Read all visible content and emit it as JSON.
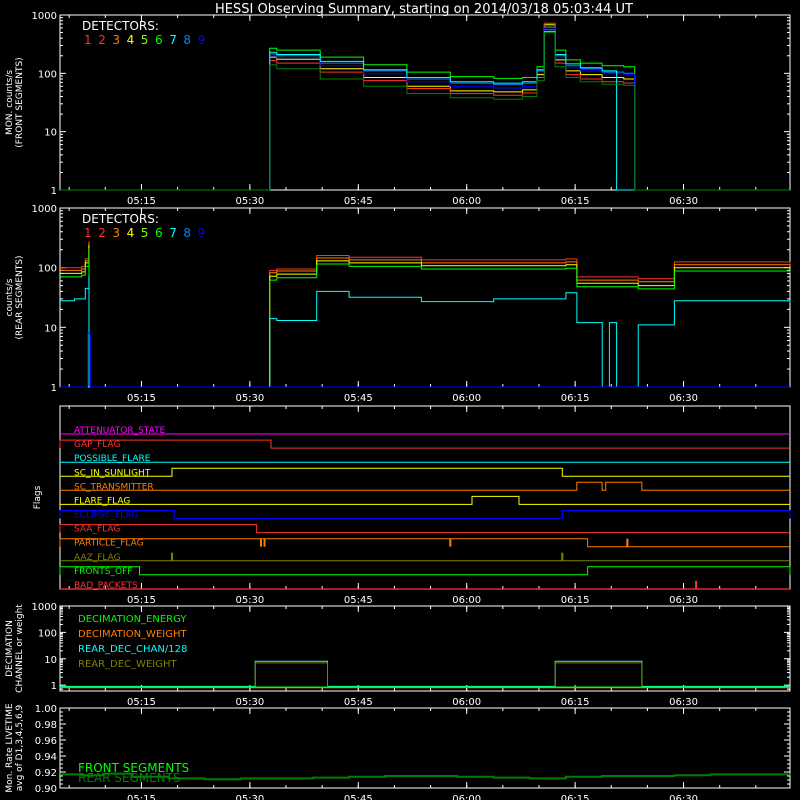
{
  "chart_data": {
    "title": "HESSI Observing Summary, starting on 2014/03/18 05:03:44 UT",
    "time_ticks": [
      "05:15",
      "05:30",
      "05:45",
      "06:00",
      "06:15",
      "06:30"
    ],
    "time_tick_minutes": [
      11.27,
      26.27,
      41.27,
      56.27,
      71.27,
      86.27
    ],
    "time_range_minutes": [
      0,
      101
    ],
    "detector_colors": [
      "#ff3030",
      "#ff3030",
      "#ff7f00",
      "#ffff00",
      "#7fff00",
      "#00ff00",
      "#00ffff",
      "#0080ff",
      "#0000ff"
    ],
    "detector_numbers": [
      "1",
      "2",
      "3",
      "4",
      "5",
      "6",
      "7",
      "8",
      "9"
    ],
    "panels": [
      {
        "id": "front",
        "type": "line",
        "ylabel_line1": "MON. counts/s",
        "ylabel_line2": "(FRONT SEGMENTS)",
        "legend_label": "DETECTORS:",
        "yscale": "log",
        "ylim": [
          1,
          1000
        ],
        "yticks": [
          "1",
          "10",
          "100",
          "1000"
        ],
        "series": [
          {
            "color": "#00ff00",
            "x": [
              0,
              29.0,
              29.01,
              30,
              36,
              42,
              48,
              54,
              60,
              64,
              66,
              67,
              68.5,
              70,
              72,
              75,
              78,
              79.5,
              79.51,
              101
            ],
            "y": [
              1,
              1,
              270,
              250,
              190,
              140,
              105,
              88,
              82,
              85,
              130,
              620,
              250,
              170,
              150,
              135,
              130,
              130,
              1,
              1
            ]
          },
          {
            "color": "#ffff00",
            "x": [
              0,
              29.0,
              29.01,
              30,
              36,
              42,
              48,
              54,
              60,
              64,
              66,
              67,
              68.5,
              70,
              72,
              75,
              78,
              79.5,
              79.51,
              101
            ],
            "y": [
              1,
              1,
              190,
              175,
              120,
              85,
              60,
              50,
              48,
              52,
              95,
              680,
              170,
              110,
              95,
              85,
              80,
              80,
              1,
              1
            ]
          },
          {
            "color": "#ff3030",
            "x": [
              0,
              29.0,
              29.01,
              30,
              36,
              42,
              48,
              54,
              60,
              64,
              66,
              67,
              68.5,
              70,
              72,
              75,
              78,
              79.5,
              79.51,
              101
            ],
            "y": [
              1,
              1,
              165,
              150,
              105,
              75,
              55,
              45,
              42,
              46,
              85,
              720,
              150,
              95,
              80,
              72,
              68,
              68,
              1,
              1
            ]
          },
          {
            "color": "#0080ff",
            "x": [
              0,
              29.0,
              29.01,
              30,
              36,
              42,
              48,
              54,
              60,
              64,
              66,
              67,
              68.5,
              70,
              72,
              75,
              78,
              79.5,
              79.51,
              101
            ],
            "y": [
              1,
              1,
              215,
              200,
              150,
              110,
              80,
              68,
              64,
              68,
              110,
              560,
              200,
              135,
              120,
              105,
              100,
              100,
              1,
              1
            ]
          },
          {
            "color": "#0000ff",
            "x": [
              0,
              29.0,
              29.01,
              30,
              36,
              42,
              48,
              54,
              60,
              64,
              66,
              67,
              68.5,
              70,
              72,
              75,
              78,
              79.5,
              79.51,
              101
            ],
            "y": [
              1,
              1,
              200,
              185,
              135,
              98,
              72,
              60,
              56,
              60,
              100,
              600,
              185,
              125,
              110,
              98,
              95,
              95,
              1,
              1
            ]
          },
          {
            "color": "#00ffff",
            "x": [
              0,
              29.0,
              29.01,
              30,
              36,
              42,
              48,
              54,
              60,
              64,
              66,
              67,
              68.5,
              70,
              72,
              75,
              77.0,
              77.01,
              101
            ],
            "y": [
              1,
              1,
              230,
              210,
              160,
              115,
              85,
              72,
              68,
              72,
              115,
              520,
              210,
              145,
              125,
              110,
              105,
              1,
              1
            ]
          },
          {
            "color": "#008000",
            "x": [
              0,
              29.0,
              29.01,
              30,
              36,
              42,
              48,
              54,
              60,
              64,
              66,
              67,
              68.5,
              70,
              72,
              75,
              78,
              79.5,
              79.51,
              101
            ],
            "y": [
              1,
              1,
              140,
              120,
              80,
              60,
              45,
              38,
              36,
              40,
              75,
              500,
              130,
              85,
              72,
              65,
              62,
              62,
              1,
              1
            ]
          }
        ]
      },
      {
        "id": "rear",
        "type": "line",
        "ylabel_line1": "counts/s",
        "ylabel_line2": "(REAR SEGMENTS)",
        "legend_label": "DETECTORS:",
        "yscale": "log",
        "ylim": [
          1,
          1000
        ],
        "yticks": [
          "1",
          "10",
          "100",
          "1000"
        ],
        "series": [
          {
            "color": "#ff3030",
            "x": [
              0,
              3,
              3.5,
              4.0,
              4.01,
              29.0,
              29.01,
              30,
              35.5,
              35.51,
              40,
              50,
              60,
              70,
              71.5,
              71.51,
              80,
              85,
              85.01,
              101
            ],
            "y": [
              100,
              105,
              140,
              270,
              1,
              1,
              90,
              95,
              95,
              160,
              150,
              135,
              135,
              140,
              140,
              70,
              65,
              65,
              125,
              115
            ]
          },
          {
            "color": "#ff7f00",
            "x": [
              0,
              3,
              3.5,
              4.0,
              4.01,
              29.0,
              29.01,
              30,
              35.5,
              35.51,
              40,
              50,
              60,
              70,
              71.5,
              71.51,
              80,
              85,
              85.01,
              101
            ],
            "y": [
              90,
              95,
              130,
              250,
              1,
              1,
              82,
              88,
              88,
              145,
              135,
              120,
              120,
              125,
              125,
              62,
              58,
              58,
              112,
              105
            ]
          },
          {
            "color": "#ffff00",
            "x": [
              0,
              3,
              3.5,
              4.0,
              4.01,
              29.0,
              29.01,
              30,
              35.5,
              35.51,
              40,
              50,
              60,
              70,
              71.5,
              71.51,
              80,
              85,
              85.01,
              101
            ],
            "y": [
              80,
              85,
              120,
              230,
              1,
              1,
              72,
              78,
              78,
              130,
              120,
              108,
              108,
              112,
              112,
              55,
              50,
              50,
              100,
              95
            ]
          },
          {
            "color": "#00ff00",
            "x": [
              0,
              3,
              3.5,
              4.0,
              4.01,
              29.0,
              29.01,
              30,
              35.5,
              35.51,
              40,
              50,
              60,
              70,
              71.5,
              71.51,
              80,
              85,
              85.01,
              101
            ],
            "y": [
              70,
              75,
              105,
              210,
              1,
              1,
              62,
              68,
              68,
              115,
              105,
              95,
              95,
              98,
              98,
              48,
              44,
              44,
              88,
              82
            ]
          },
          {
            "color": "#00ffff",
            "x": [
              0,
              2,
              3.5,
              4.0,
              4.01,
              29.0,
              29.01,
              30,
              35.5,
              35.51,
              40,
              50,
              60,
              70,
              71.5,
              71.51,
              75,
              75.01,
              76,
              76.01,
              77,
              77.01,
              80,
              85,
              85.01,
              101
            ],
            "y": [
              28,
              30,
              45,
              70,
              1,
              1,
              14,
              13,
              13,
              40,
              32,
              27,
              30,
              38,
              38,
              12,
              12,
              1,
              1,
              12,
              12,
              1,
              11,
              11,
              28,
              26
            ]
          },
          {
            "color": "#0000ff",
            "x": [
              0,
              3.8,
              3.81,
              4.2,
              4.21,
              101
            ],
            "y": [
              1,
              1,
              8,
              8,
              1,
              1
            ]
          }
        ]
      },
      {
        "id": "flags",
        "type": "flags",
        "ylabel": "Flags",
        "rows": [
          {
            "label": "ATTENUATOR_STATE",
            "color": "#ff00ff",
            "segments": []
          },
          {
            "label": "GAP_FLAG",
            "color": "#ff3030",
            "segments": [
              [
                0,
                29.2
              ]
            ]
          },
          {
            "label": "POSSIBLE_FLARE",
            "color": "#00ffff",
            "segments": []
          },
          {
            "label": "SC_IN_SUNLIGHT",
            "color": "#ffff00",
            "segments": [
              [
                15.5,
                69.5
              ]
            ]
          },
          {
            "label": "SC_TRANSMITTER",
            "color": "#ff7f00",
            "segments": [
              [
                71.5,
                75.0
              ],
              [
                75.5,
                80.5
              ]
            ]
          },
          {
            "label": "FLARE_FLAG",
            "color": "#ffff00",
            "segments": [
              [
                57.0,
                63.5
              ]
            ]
          },
          {
            "label": "ECLIPSE_FLAG",
            "color": "#0000ff",
            "segments": [
              [
                0,
                15.8
              ],
              [
                69.5,
                101
              ]
            ]
          },
          {
            "label": "SAA_FLAG",
            "color": "#ff3030",
            "segments": [
              [
                0,
                27.2
              ]
            ]
          },
          {
            "label": "PARTICLE_FLAG",
            "color": "#ff7f00",
            "segments": [
              [
                0,
                73.0
              ]
            ],
            "spikes": [
              27.8,
              28.3,
              54.0,
              78.5
            ]
          },
          {
            "label": "AAZ_FLAG",
            "color": "#808000",
            "segments": [],
            "spikes": [
              15.5,
              69.5
            ]
          },
          {
            "label": "FRONTS_OFF",
            "color": "#00ff00",
            "segments": [
              [
                0,
                11.0
              ],
              [
                73.0,
                101
              ]
            ]
          },
          {
            "label": "BAD_PACKETS",
            "color": "#ff3030",
            "segments": [],
            "spikes": [
              88.0
            ]
          }
        ]
      },
      {
        "id": "decimation",
        "type": "line",
        "ylabel_line1": "DECIMATION",
        "ylabel_line2": "CHANNEL or weight",
        "yscale": "log",
        "ylim": [
          0.6,
          1000
        ],
        "yticks": [
          "1",
          "10",
          "100",
          "1000"
        ],
        "legend": [
          {
            "label": "DECIMATION_ENERGY",
            "color": "#00ff00"
          },
          {
            "label": "DECIMATION_WEIGHT",
            "color": "#ff7f00"
          },
          {
            "label": "REAR_DEC_CHAN/128",
            "color": "#00ffff"
          },
          {
            "label": "REAR_DEC_WEIGHT",
            "color": "#808000"
          }
        ],
        "series": [
          {
            "color": "#00ffff",
            "x": [
              0,
              27.0,
              27.01,
              37.0,
              37.01,
              68.5,
              68.51,
              80.5,
              80.51,
              101
            ],
            "y": [
              0.9,
              0.9,
              8,
              8,
              0.9,
              0.9,
              8,
              8,
              0.9,
              0.9
            ]
          },
          {
            "color": "#808000",
            "x": [
              0,
              27.0,
              27.01,
              37.0,
              37.01,
              68.5,
              68.51,
              80.5,
              80.51,
              101
            ],
            "y": [
              0.82,
              0.82,
              7,
              7,
              0.82,
              0.82,
              7,
              7,
              0.82,
              0.82
            ]
          },
          {
            "color": "#00ff00",
            "x": [
              0,
              101
            ],
            "y": [
              0.85,
              0.85
            ]
          },
          {
            "color": "#ff7f00",
            "x": [
              0,
              101
            ],
            "y": [
              0.8,
              0.8
            ]
          }
        ]
      },
      {
        "id": "livetime",
        "type": "line",
        "ylabel_line1": "Mon. Rate LIVETIME",
        "ylabel_line2": "avg of D1,3,4,5,6,9",
        "yscale": "linear",
        "ylim": [
          0.9,
          1.0
        ],
        "yticks": [
          "0.90",
          "0.92",
          "0.94",
          "0.96",
          "0.98",
          "1.00"
        ],
        "legend": [
          {
            "label": "FRONT SEGMENTS",
            "color": "#00ff00"
          },
          {
            "label": "REAR SEGMENTS",
            "color": "#008000"
          }
        ],
        "series": [
          {
            "color": "#008000",
            "x": [
              0,
              3,
              6,
              10,
              15,
              20,
              25,
              30,
              35,
              40,
              45,
              50,
              55,
              60,
              65,
              70,
              75,
              80,
              85,
              90,
              95,
              101
            ],
            "y": [
              0.917,
              0.916,
              0.918,
              0.914,
              0.912,
              0.911,
              0.912,
              0.912,
              0.913,
              0.914,
              0.915,
              0.915,
              0.914,
              0.913,
              0.912,
              0.914,
              0.915,
              0.915,
              0.916,
              0.917,
              0.917,
              0.918
            ]
          }
        ]
      }
    ]
  }
}
